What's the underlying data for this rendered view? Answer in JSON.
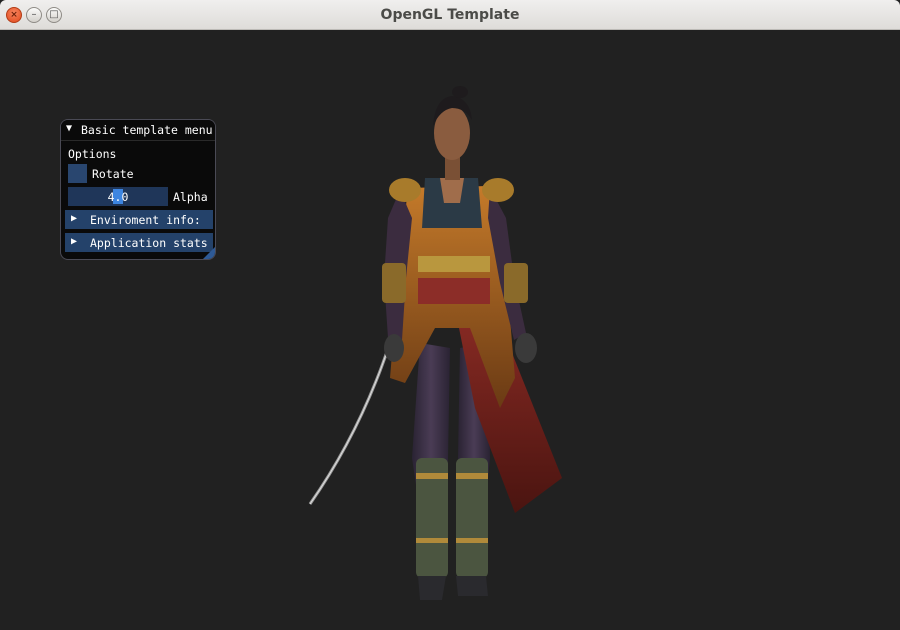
{
  "window": {
    "title": "OpenGL Template",
    "close_glyph": "×",
    "minimize_glyph": "–",
    "maximize_glyph": "□"
  },
  "menu": {
    "title": "Basic template menu",
    "collapse_glyph": "▼",
    "section_label": "Options",
    "rotate": {
      "label": "Rotate",
      "checked": false
    },
    "alpha": {
      "label": "Alpha",
      "value": "4.0",
      "fraction": 0.5
    },
    "collapsed_glyph": "▶",
    "environment_header": "Enviroment info:",
    "stats_header": "Application stats"
  },
  "colors": {
    "background": "#212121",
    "imgui_frame": "#29466f",
    "imgui_header": "#24426a",
    "slider_grab": "#3d85e0"
  }
}
